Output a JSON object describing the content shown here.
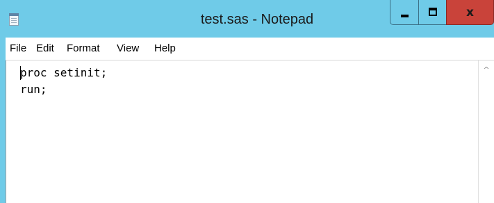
{
  "window": {
    "title": "test.sas - Notepad",
    "close_glyph": "x",
    "icon": "notepad-icon",
    "colors": {
      "titlebar": "#6fcbe8",
      "close_button": "#c9433a"
    }
  },
  "menu": {
    "items": [
      "File",
      "Edit",
      "Format",
      "View",
      "Help"
    ]
  },
  "editor": {
    "lines": [
      "proc setinit;",
      "run;"
    ]
  },
  "scrollbar": {
    "up_arrow": "^"
  }
}
